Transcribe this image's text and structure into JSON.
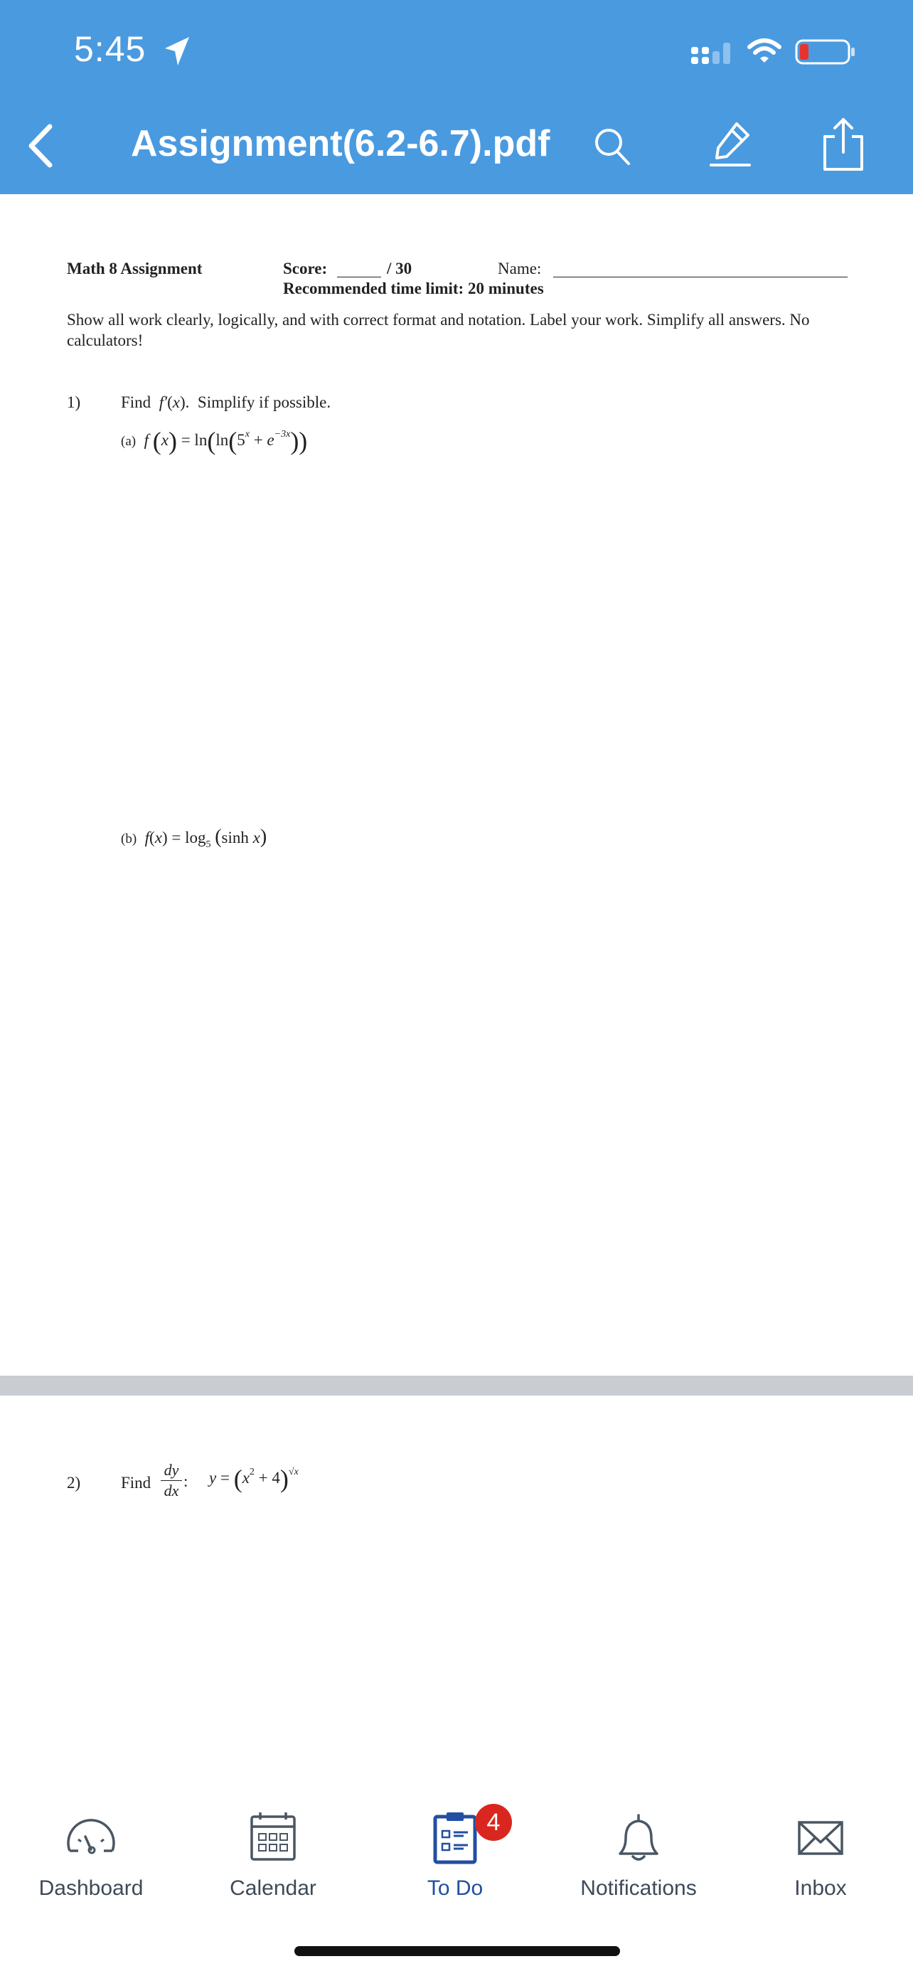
{
  "status_bar": {
    "time": "5:45"
  },
  "header": {
    "title": "Assignment(6.2-6.7).pdf"
  },
  "document": {
    "course": "Math 8 Assignment",
    "score_label": "Score:",
    "score_total": "/ 30",
    "time_limit": "Recommended time limit: 20 minutes",
    "name_label": "Name:",
    "instructions": "Show all work clearly, logically, and with correct format and notation.  Label your work.  Simplify all answers.  No calculators!",
    "q1": {
      "number": "1)",
      "prompt": "Simplify if possible.",
      "part_a_label": "(a)",
      "part_b_label": "(b)"
    },
    "q2": {
      "number": "2)",
      "prompt": "Find"
    }
  },
  "tabbar": {
    "items": [
      {
        "label": "Dashboard",
        "icon": "dashboard-icon"
      },
      {
        "label": "Calendar",
        "icon": "calendar-icon"
      },
      {
        "label": "To Do",
        "icon": "todo-icon",
        "badge": "4",
        "active": true
      },
      {
        "label": "Notifications",
        "icon": "bell-icon"
      },
      {
        "label": "Inbox",
        "icon": "envelope-icon"
      }
    ]
  },
  "colors": {
    "header_bg": "#4a9ae0",
    "active_tab": "#214fa2",
    "badge": "#d9271f"
  }
}
